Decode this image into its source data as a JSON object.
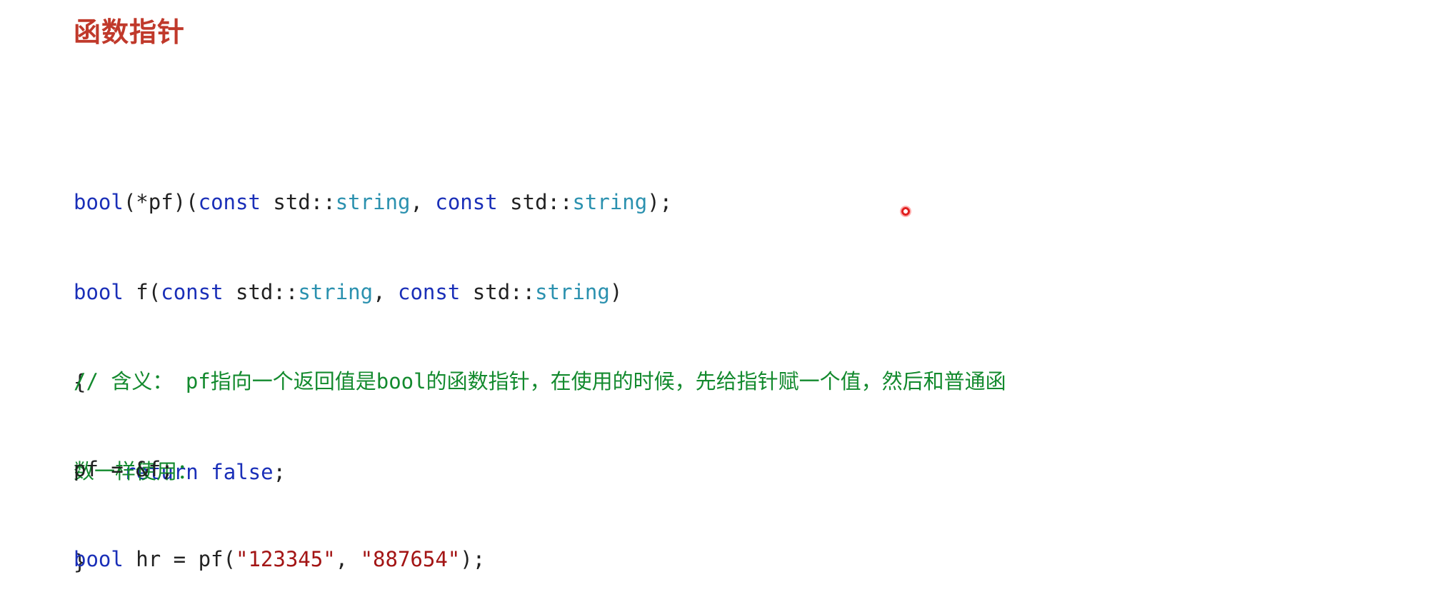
{
  "title": "函数指针",
  "code_block_1": {
    "line1": {
      "t1": "bool",
      "t2": "(*pf)(",
      "t3": "const",
      "t4": " std::",
      "t5": "string",
      "t6": ", ",
      "t7": "const",
      "t8": " std::",
      "t9": "string",
      "t10": ");"
    },
    "line2": {
      "t1": "bool",
      "t2": " f(",
      "t3": "const",
      "t4": " std::",
      "t5": "string",
      "t6": ", ",
      "t7": "const",
      "t8": " std::",
      "t9": "string",
      "t10": ")"
    },
    "line3": "{",
    "line4": {
      "t1": "return",
      "t2": " ",
      "t3": "false",
      "t4": ";"
    },
    "line5": "}"
  },
  "comment": {
    "line1": "// 含义： pf指向一个返回值是bool的函数指针，在使用的时候，先给指针赋一个值，然后和普通函",
    "line2": "数一样使用："
  },
  "code_block_2": {
    "line1": "pf = &f;",
    "line2": {
      "t1": "bool",
      "t2": " hr = pf(",
      "t3": "\"123345\"",
      "t4": ", ",
      "t5": "\"887654\"",
      "t6": ");"
    }
  },
  "colors": {
    "title": "#c0392b",
    "keyword": "#1a2fb8",
    "type": "#2b91af",
    "string": "#a31515",
    "comment": "#138a2e"
  }
}
